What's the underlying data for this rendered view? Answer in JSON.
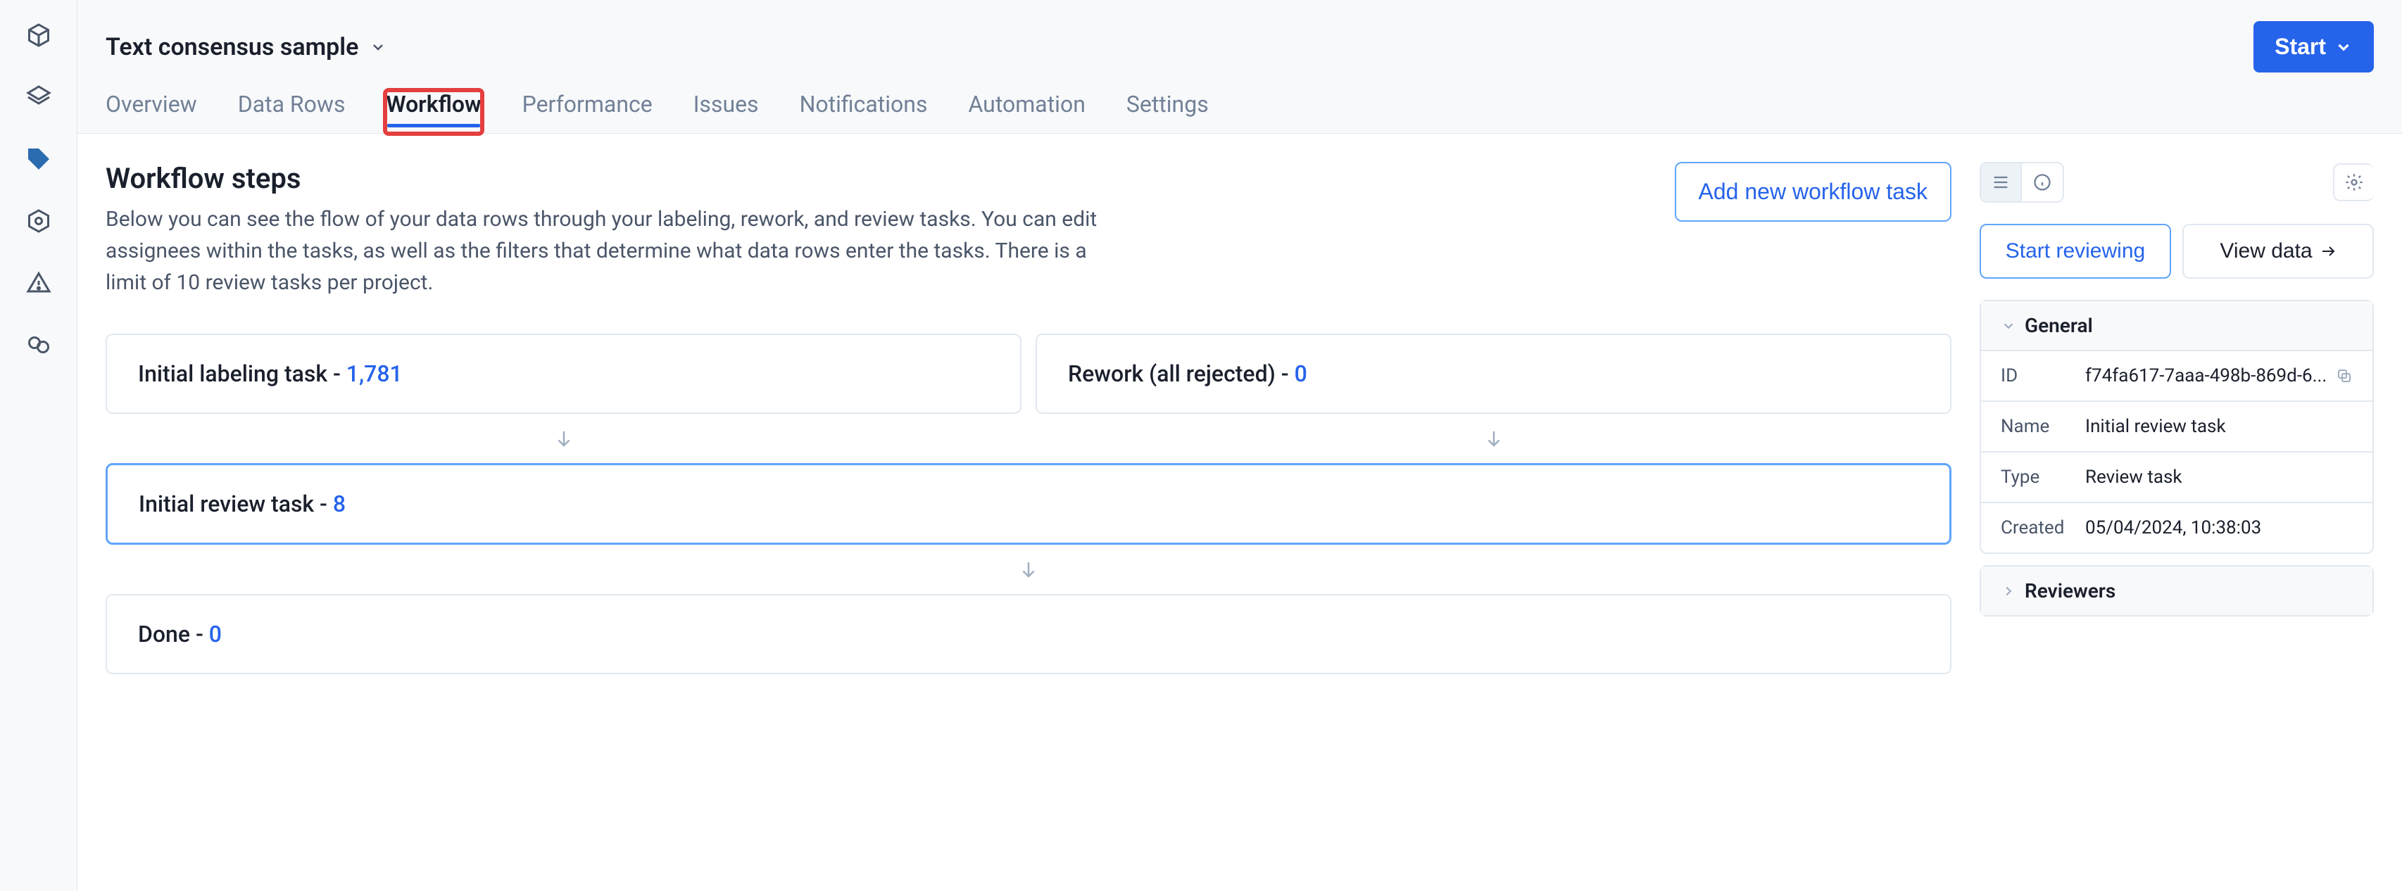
{
  "header": {
    "title": "Text consensus sample",
    "start_label": "Start"
  },
  "tabs": [
    {
      "label": "Overview"
    },
    {
      "label": "Data Rows"
    },
    {
      "label": "Workflow"
    },
    {
      "label": "Performance"
    },
    {
      "label": "Issues"
    },
    {
      "label": "Notifications"
    },
    {
      "label": "Automation"
    },
    {
      "label": "Settings"
    }
  ],
  "steps": {
    "title": "Workflow steps",
    "description": "Below you can see the flow of your data rows through your labeling, rework, and review tasks. You can edit assignees within the tasks, as well as the filters that determine what data rows enter the tasks. There is a limit of 10 review tasks per project.",
    "add_button": "Add new workflow task"
  },
  "flow": {
    "initial_labeling": {
      "label": "Initial labeling task",
      "count": "1,781"
    },
    "rework": {
      "label": "Rework (all rejected)",
      "count": "0"
    },
    "initial_review": {
      "label": "Initial review task",
      "count": "8"
    },
    "done": {
      "label": "Done",
      "count": "0"
    }
  },
  "panel": {
    "start_reviewing": "Start reviewing",
    "view_data": "View data",
    "general": {
      "title": "General",
      "id_label": "ID",
      "id_value": "f74fa617-7aaa-498b-869d-6...",
      "name_label": "Name",
      "name_value": "Initial review task",
      "type_label": "Type",
      "type_value": "Review task",
      "created_label": "Created",
      "created_value": "05/04/2024, 10:38:03"
    },
    "reviewers": {
      "title": "Reviewers"
    }
  }
}
